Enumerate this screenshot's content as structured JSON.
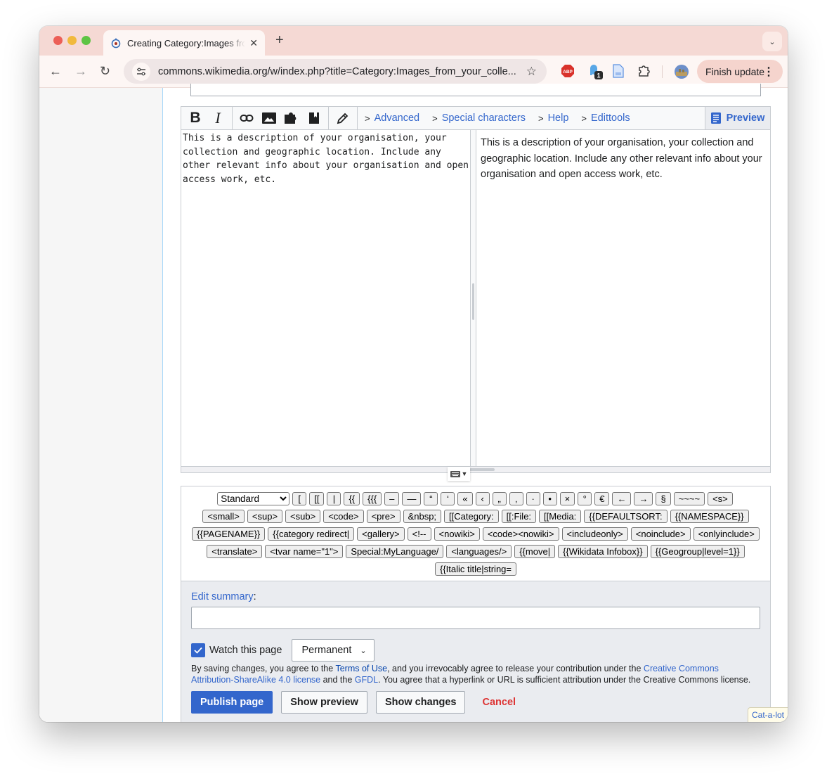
{
  "browser": {
    "tab_title": "Creating Category:Images from your collection",
    "url": "commons.wikimedia.org/w/index.php?title=Category:Images_from_your_colle...",
    "extensions": [
      {
        "name": "adblock-plus",
        "label": "ABP"
      },
      {
        "name": "ghostery",
        "badge": "1"
      },
      {
        "name": "docs"
      },
      {
        "name": "extensions"
      }
    ],
    "finish_update_label": "Finish update"
  },
  "toolbar": {
    "tabs": [
      {
        "label": "Advanced"
      },
      {
        "label": "Special characters"
      },
      {
        "label": "Help"
      },
      {
        "label": "Edittools"
      }
    ],
    "preview_label": "Preview"
  },
  "editor": {
    "source_text": "This is a description of your organisation, your collection and geographic location. Include any other relevant info about your organisation and open access work, etc.",
    "preview_text": "This is a description of your organisation, your collection and geographic location. Include any other relevant info about your organisation and open access work, etc."
  },
  "edittools": {
    "selected_set": "Standard",
    "buttons": [
      "[",
      "[[",
      "|",
      "{{",
      "{{{",
      "–",
      "—",
      "“",
      "‘",
      "«",
      "‹",
      "„",
      "‚",
      "·",
      "•",
      "×",
      "°",
      "€",
      "←",
      "→",
      "§",
      "~~~~",
      "<s>",
      "<small>",
      "<sup>",
      "<sub>",
      "<code>",
      "<pre>",
      "&nbsp;",
      "[[Category:",
      "[[:File:",
      "[[Media:",
      "{{DEFAULTSORT:",
      "{{NAMESPACE}}",
      "{{PAGENAME}}",
      "{{category redirect|",
      "<gallery>",
      "<!--",
      "<nowiki>",
      "<code><nowiki>",
      "<includeonly>",
      "<noinclude>",
      "<onlyinclude>",
      "<translate>",
      "<tvar name=\"1\">",
      "Special:MyLanguage/",
      "<languages/>",
      "{{move|",
      "{{Wikidata Infobox}}",
      "{{Geogroup|level=1}}",
      "{{Italic title|string="
    ]
  },
  "save": {
    "summary_label": "Edit summary",
    "summary_colon": ":",
    "summary_value": "",
    "watch_label": "Watch this page",
    "watch_checked": true,
    "watch_period": "Permanent",
    "license": {
      "t1": "By saving changes, you agree to the ",
      "terms": "Terms of Use",
      "t2": ", and you irrevocably agree to release your contribution under the ",
      "cc": "Creative Commons Attribution-ShareAlike 4.0 license",
      "t3": " and the ",
      "gfdl": "GFDL",
      "t4": ". You agree that a hyperlink or URL is sufficient attribution under the Creative Commons license."
    },
    "publish_label": "Publish page",
    "show_preview_label": "Show preview",
    "show_changes_label": "Show changes",
    "cancel_label": "Cancel"
  },
  "catalot_label": "Cat-a-lot"
}
